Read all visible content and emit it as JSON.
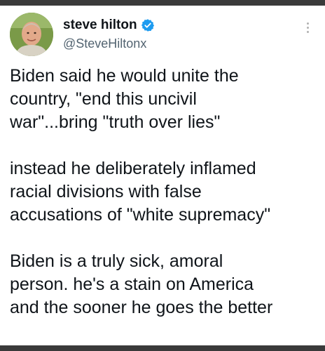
{
  "user": {
    "display_name": "steve hilton",
    "handle": "@SteveHiltonx",
    "verified_icon": "verified-badge-icon",
    "badge_color": "#1d9bf0"
  },
  "menu": {
    "icon": "more-options-icon"
  },
  "tweet": {
    "paragraphs": [
      [
        "Biden said he would unite the",
        "country, \"end this uncivil",
        "war\"...bring \"truth over lies\""
      ],
      [
        "instead he deliberately inflamed",
        "racial divisions with false",
        "accusations of \"white supremacy\""
      ],
      [
        "Biden is a truly sick, amoral",
        "person. he's a stain on America",
        "and the sooner he goes the better"
      ]
    ]
  }
}
